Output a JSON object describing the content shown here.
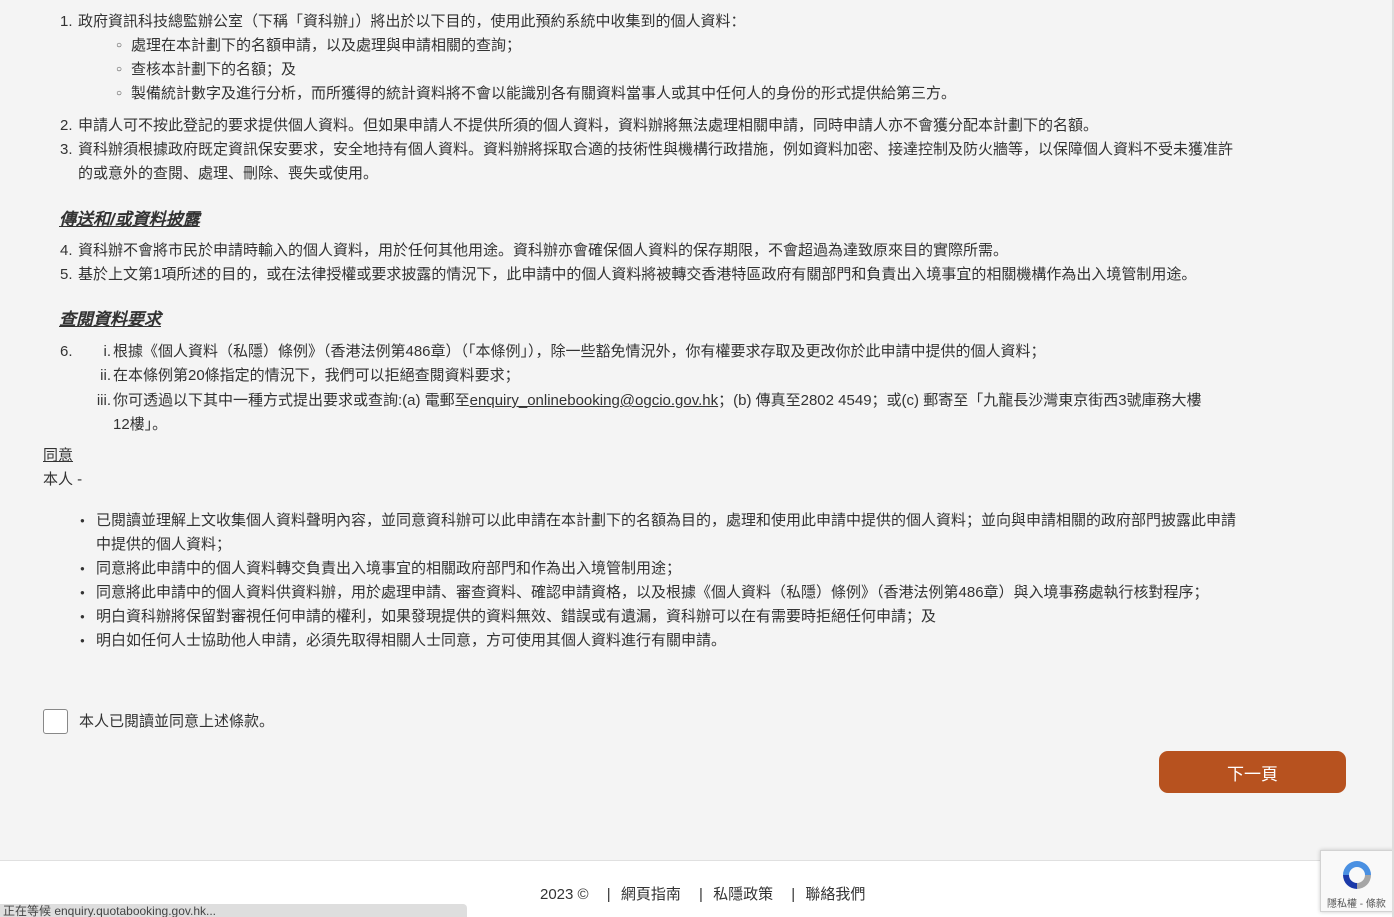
{
  "purpose": {
    "item1_num": "1.",
    "item1_text": "政府資訊科技總監辦公室（下稱「資科辦」）將出於以下目的，使用此預約系統中收集到的個人資料：",
    "sub_bullets": [
      "處理在本計劃下的名額申請，以及處理與申請相關的查詢；",
      "查核本計劃下的名額；及",
      "製備統計數字及進行分析，而所獲得的統計資料將不會以能識別各有關資料當事人或其中任何人的身份的形式提供給第三方。"
    ],
    "item2_num": "2.",
    "item2_text": "申請人可不按此登記的要求提供個人資料。但如果申請人不提供所須的個人資料，資料辦將無法處理相關申請，同時申請人亦不會獲分配本計劃下的名額。",
    "item3_num": "3.",
    "item3_text_line1": "資科辦須根據政府既定資訊保安要求，安全地持有個人資料。資料辦將採取合適的技術性與機構行政措施，例如資料加密、接達控制及防火牆等，以保障個人資料不受未獲准許",
    "item3_text_line2": "的或意外的查閱、處理、刪除、喪失或使用。"
  },
  "transfer": {
    "heading": "傳送和/或資料披露",
    "item4_num": "4.",
    "item4_text": "資科辦不會將市民於申請時輸入的個人資料，用於任何其他用途。資科辦亦會確保個人資料的保存期限，不會超過為達致原來目的實際所需。",
    "item5_num": "5.",
    "item5_text": "基於上文第1項所述的目的，或在法律授權或要求披露的情況下，此申請中的個人資料將被轉交香港特區政府有關部門和負責出入境事宜的相關機構作為出入境管制用途。"
  },
  "access": {
    "heading": "查閱資料要求",
    "item6_num": "6.",
    "roman_i_num": "i.",
    "roman_i_text": "根據《個人資料（私隱）條例》（香港法例第486章）（「本條例」），除一些豁免情況外，你有權要求存取及更改你於此申請中提供的個人資料；",
    "roman_ii_num": "ii.",
    "roman_ii_text": "在本條例第20條指定的情況下，我們可以拒絕查閱資料要求；",
    "roman_iii_num": "iii.",
    "roman_iii_text_a": "你可透過以下其中一種方式提出要求或查詢:(a) 電郵至",
    "roman_iii_email": "enquiry_onlinebooking@ogcio.gov.hk",
    "roman_iii_text_b": "；(b) 傳真至2802 4549；或(c) 郵寄至「九龍長沙灣東京街西3號庫務大樓",
    "roman_iii_text_c": "12樓」。"
  },
  "consent": {
    "title": "同意",
    "subtitle": "本人 -",
    "bullets": [
      "已閱讀並理解上文收集個人資料聲明內容，並同意資科辦可以此申請在本計劃下的名額為目的，處理和使用此申請中提供的個人資料；並向與申請相關的政府部門披露此申請",
      "中提供的個人資料；",
      "同意將此申請中的個人資料轉交負責出入境事宜的相關政府部門和作為出入境管制用途；",
      "同意將此申請中的個人資料供資料辦，用於處理申請、審查資料、確認申請資格，以及根據《個人資料（私隱）條例》（香港法例第486章）與入境事務處執行核對程序；",
      "明白資科辦將保留對審視任何申請的權利，如果發現提供的資料無效、錯誤或有遺漏，資科辦可以在有需要時拒絕任何申請；及",
      "明白如任何人士協助他人申請，必須先取得相關人士同意，方可使用其個人資料進行有關申請。"
    ],
    "checkbox_label": "本人已閱讀並同意上述條款。"
  },
  "next_button": "下一頁",
  "footer": {
    "copyright": "2023 ©",
    "link1": "網頁指南",
    "link2": "私隱政策",
    "link3": "聯絡我們",
    "separator": "|"
  },
  "status_bar": "正在等候 enquiry.quotabooking.gov.hk...",
  "recaptcha_text": "隱私權 - 條款",
  "colors": {
    "primary_button": "#b7521f",
    "background": "#f4f4f4"
  }
}
